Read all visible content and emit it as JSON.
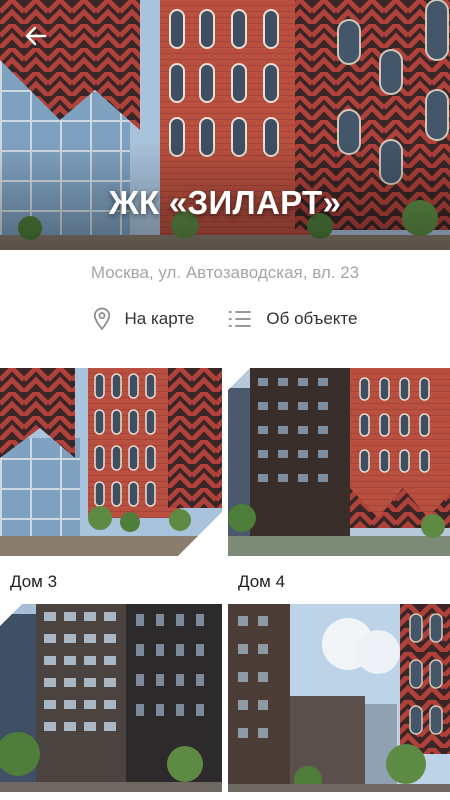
{
  "header": {
    "title": "ЖК «ЗИЛАРТ»",
    "back_icon": "arrow-left-icon"
  },
  "info": {
    "address": "Москва, ул. Автозаводская, вл. 23",
    "actions": [
      {
        "label": "На карте",
        "icon": "map-pin-icon"
      },
      {
        "label": "Об объекте",
        "icon": "list-icon"
      }
    ]
  },
  "houses": [
    {
      "name": "Дом 3"
    },
    {
      "name": "Дом 4"
    },
    {
      "name": ""
    },
    {
      "name": ""
    }
  ],
  "colors": {
    "brick_red": "#b5473a",
    "dark_brick": "#2a2424",
    "sky": "#a9c3dc",
    "muted_text": "#a5a5a5"
  }
}
